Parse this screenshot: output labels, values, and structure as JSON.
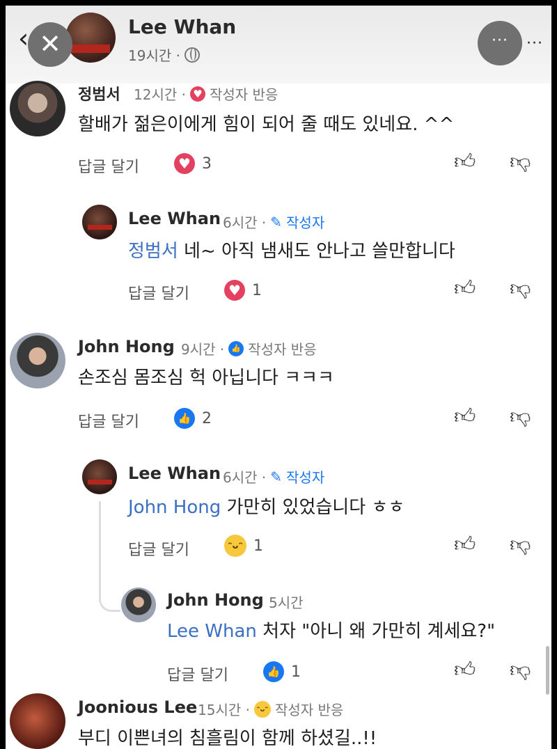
{
  "header": {
    "name": "Lee Whan",
    "time": "19시간 ·",
    "close_icon": "✕",
    "more_icon": "···",
    "back_icon": "‹"
  },
  "labels": {
    "reply": "답글 달기",
    "author_reaction": "작성자 반응",
    "author": "작성자"
  },
  "comments": [
    {
      "author": "정범서",
      "time": "12시간 ·",
      "badge_icon": "heart",
      "text": "할배가 젊은이에게  힘이 되어 줄 때도 있네요. ^^",
      "reaction_icon": "heart",
      "reaction_count": "3"
    },
    {
      "author": "Lee Whan",
      "time": "6시간 ·",
      "mention": "정범서",
      "text": " 네~ 아직 냄새도 안나고 쓸만합니다",
      "reaction_icon": "heart",
      "reaction_count": "1"
    },
    {
      "author": "John Hong",
      "time": "9시간 ·",
      "badge_icon": "like",
      "text": "손조심 몸조심 헉 아닙니다 ㅋㅋㅋ",
      "reaction_icon": "like",
      "reaction_count": "2"
    },
    {
      "author": "Lee Whan",
      "time": "6시간 ·",
      "mention": "John Hong",
      "text": " 가만히 있었습니다 ㅎㅎ",
      "reaction_icon": "haha",
      "reaction_count": "1"
    },
    {
      "author": "John Hong",
      "time": "5시간",
      "mention": "Lee Whan",
      "text": " 처자 \"아니 왜 가만히 계세요?\"",
      "reaction_icon": "like",
      "reaction_count": "1"
    },
    {
      "author": "Joonious Lee",
      "time": "15시간 ·",
      "badge_icon": "haha",
      "text": "부디 이쁜녀의 침흘림이 함께 하셨길..!!"
    }
  ],
  "icons": {
    "like_outline": "👍︎",
    "dislike_outline": "👎︎"
  },
  "colors": {
    "mention": "#3b6fc4",
    "like": "#1877f2",
    "heart": "#e4405f",
    "haha": "#f7c83b"
  }
}
